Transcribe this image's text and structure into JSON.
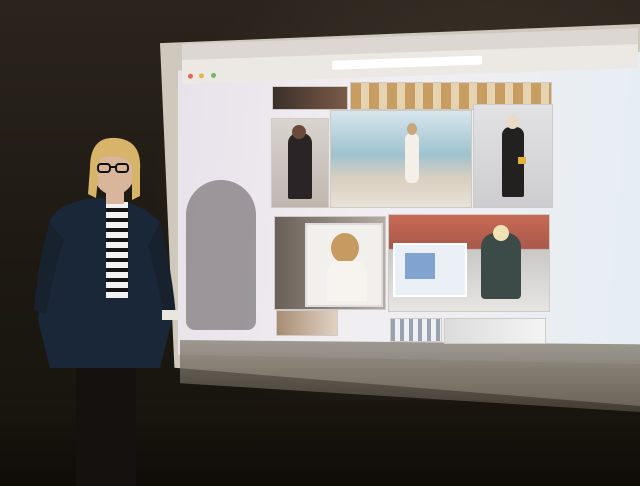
{
  "scene": {
    "subject": "presenter-standing-before-projected-website",
    "colors": {
      "wall": "#2a241c",
      "screen": "#eeeaf0",
      "jacket": "#1a2738",
      "stripes": "#f2f2f2",
      "hair": "#d8b36a"
    }
  },
  "browser": {
    "menu_items": [
      "",
      "",
      "",
      "",
      "",
      "",
      ""
    ],
    "url": ""
  },
  "gallery": {
    "captions": [
      "",
      "",
      "",
      "",
      "",
      ""
    ]
  }
}
